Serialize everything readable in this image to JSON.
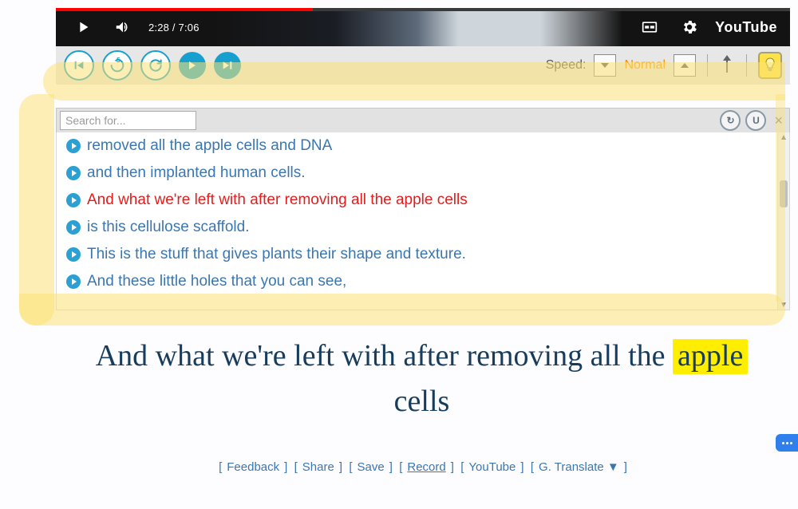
{
  "player": {
    "progress_pct": 35,
    "time_current": "2:28",
    "time_total": "7:06",
    "time_display": "2:28 / 7:06",
    "logo": "YouTube"
  },
  "toolbar": {
    "rewind5_label": "-5",
    "speed_label": "Speed:",
    "speed_value": "Normal"
  },
  "search": {
    "placeholder": "Search for...",
    "refresh_icon": "↻",
    "u_icon": "U"
  },
  "transcript": {
    "lines": [
      {
        "text": "removed all the apple cells and DNA",
        "current": false
      },
      {
        "text": "and then implanted human cells.",
        "current": false
      },
      {
        "text": "And what we're left with after removing all the apple cells",
        "current": true
      },
      {
        "text": "is this cellulose scaffold.",
        "current": false
      },
      {
        "text": "This is the stuff that gives plants their shape and texture.",
        "current": false
      },
      {
        "text": "And these little holes that you can see,",
        "current": false
      }
    ]
  },
  "caption": {
    "before": "And what we're left with after removing all the ",
    "highlight": "apple",
    "after": " cells"
  },
  "links": {
    "feedback": "Feedback",
    "share": "Share",
    "save": "Save",
    "record": "Record",
    "youtube": "YouTube",
    "gtranslate": "G. Translate  ▼"
  }
}
